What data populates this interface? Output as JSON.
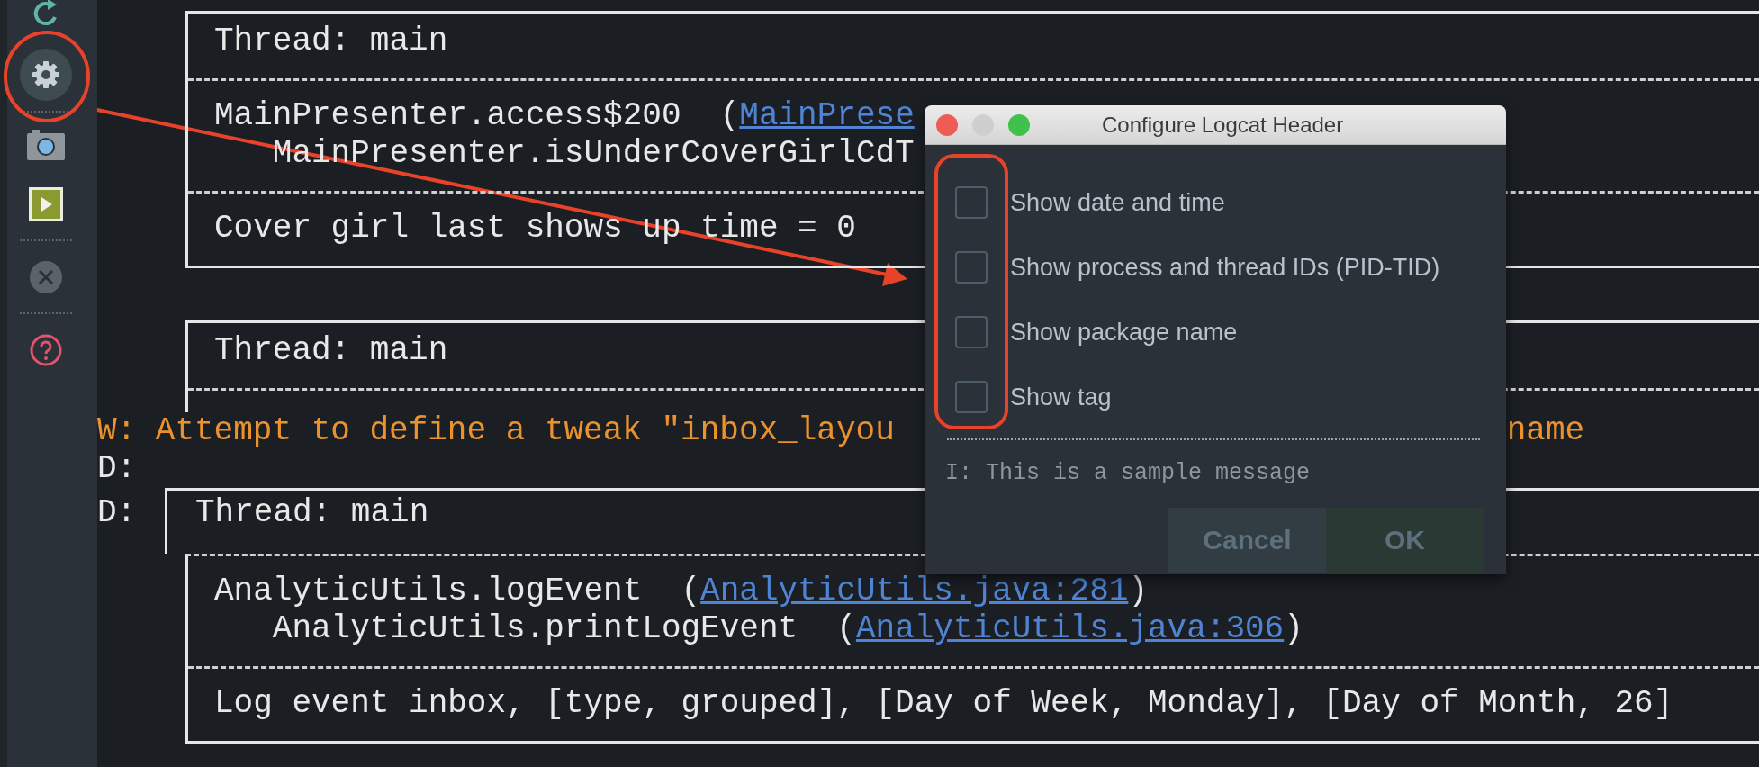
{
  "sidebar": {
    "buttons": [
      {
        "kind": "refresh",
        "selected": false
      },
      {
        "kind": "settings",
        "selected": true
      },
      {
        "kind": "separator"
      },
      {
        "kind": "camera",
        "selected": false
      },
      {
        "kind": "play",
        "selected": false
      },
      {
        "kind": "separator"
      },
      {
        "kind": "clear",
        "selected": false
      },
      {
        "kind": "separator"
      },
      {
        "kind": "help",
        "selected": false
      }
    ]
  },
  "log": {
    "entries": [
      {
        "kind": "box",
        "closed": true,
        "sections": [
          {
            "lines": [
              [
                {
                  "text": "Thread: main"
                }
              ]
            ]
          },
          {
            "lines": [
              [
                {
                  "text": "MainPresenter.access$200  ("
                },
                {
                  "text": "MainPrese",
                  "link": true
                }
              ],
              [
                {
                  "text": "   MainPresenter.isUnderCoverGirlCdT"
                }
              ]
            ]
          },
          {
            "lines": [
              [
                {
                  "text": "Cover girl last shows up time = 0"
                }
              ]
            ]
          }
        ]
      },
      {
        "kind": "box",
        "closed": false,
        "sections": [
          {
            "lines": [
              [
                {
                  "text": "Thread: main"
                }
              ]
            ]
          }
        ]
      },
      {
        "kind": "line",
        "color": "#eb922d",
        "segments": [
          {
            "text": "W: Attempt to define a tweak \"inbox_layou"
          },
          {
            "text": "name",
            "gap": true
          }
        ]
      },
      {
        "kind": "line",
        "color": "#e8e8e8",
        "segments": [
          {
            "text": "D:"
          }
        ]
      },
      {
        "kind": "box",
        "closed": true,
        "prefix": "D:",
        "sections": [
          {
            "lines": [
              [
                {
                  "text": "Thread: main"
                }
              ]
            ]
          },
          {
            "lines": [
              [
                {
                  "text": "AnalyticUtils.logEvent  ("
                },
                {
                  "text": "AnalyticUtils.java:281",
                  "link": true
                },
                {
                  "text": ")"
                }
              ],
              [
                {
                  "text": "   AnalyticUtils.printLogEvent  ("
                },
                {
                  "text": "AnalyticUtils.java:306",
                  "link": true
                },
                {
                  "text": ")"
                }
              ]
            ]
          },
          {
            "lines": [
              [
                {
                  "text": "Log event inbox, [type, grouped], [Day of Week, Monday], [Day of Month, 26]"
                }
              ]
            ]
          }
        ]
      }
    ]
  },
  "dialog": {
    "title": "Configure Logcat Header",
    "options": [
      {
        "label": "Show date and time",
        "checked": false
      },
      {
        "label": "Show process and thread IDs (PID-TID)",
        "checked": false
      },
      {
        "label": "Show package name",
        "checked": false
      },
      {
        "label": "Show tag",
        "checked": false
      }
    ],
    "sample": "I: This is a sample message",
    "buttons": [
      {
        "label": "Cancel",
        "kind": "cancel"
      },
      {
        "label": "OK",
        "kind": "ok"
      }
    ]
  }
}
